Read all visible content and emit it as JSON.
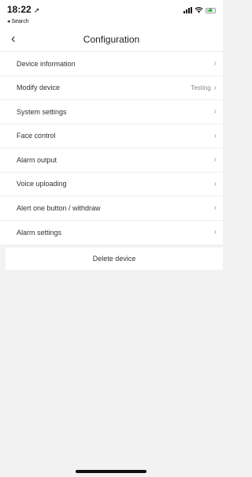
{
  "status": {
    "time": "18:22",
    "back_app": "◂ Search"
  },
  "header": {
    "back_glyph": "‹",
    "title": "Configuration"
  },
  "menu": [
    {
      "label": "Device information",
      "value": ""
    },
    {
      "label": "Modify device",
      "value": "Testing"
    },
    {
      "label": "System settings",
      "value": ""
    },
    {
      "label": "Face control",
      "value": ""
    },
    {
      "label": "Alarm output",
      "value": ""
    },
    {
      "label": "Voice uploading",
      "value": ""
    },
    {
      "label": "Alert one button / withdraw",
      "value": ""
    },
    {
      "label": "Alarm settings",
      "value": ""
    }
  ],
  "delete_button": "Delete device",
  "icons": {
    "location": "location-arrow-icon",
    "signal": "signal-icon",
    "wifi": "wifi-icon",
    "battery": "battery-charging-icon",
    "chevron": "chevron-right-icon"
  },
  "colors": {
    "battery_fill": "#4cd964",
    "background": "#f2f2f2"
  }
}
